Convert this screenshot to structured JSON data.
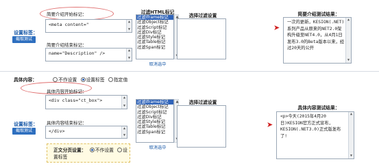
{
  "section1": {
    "settings_label": "设置标签：",
    "capture_button": "截取测试",
    "start_tag_label": "简要介绍开始标记：",
    "start_tag_value": "<meta content=\"",
    "end_tag_label": "简要介绍结束标记：",
    "end_tag_value": "name=\"Description\" />",
    "filter_title": "过滤HTML标记",
    "filter_items": [
      "过滤Iframe标记",
      "过滤Object标记",
      "过滤Script标记",
      "过滤Div标记",
      "过滤Style标记",
      "过滤Table标记",
      "过滤Span标记"
    ],
    "cancel_link": "取消选中",
    "select_title": "选择过滤设置",
    "result_title": "简要介绍测试结果：",
    "result_text": "一次的更新，KESION(.NET)系列产品从原来的NET2.0架构升级至NET4.0，从4月1日发布3.0的Beta版本以来，经过20天的公开"
  },
  "content_row": {
    "label": "具体内容：",
    "options": [
      "不作设置",
      "设置标签",
      "指定值"
    ],
    "selected": 1
  },
  "section2": {
    "settings_label": "设置标签：",
    "capture_button": "截取测试",
    "start_tag_label": "具体内容开始标记：",
    "start_tag_value": "<div class=\"ct_box\">",
    "end_tag_label": "具体内容结束标记：",
    "end_tag_value": "</div>",
    "filter_items": [
      "过滤Iframe标记",
      "过滤Object标记",
      "过滤Script标记",
      "过滤Div标记",
      "过滤Style标记",
      "过滤Table标记",
      "过滤Span标记"
    ],
    "cancel_link": "取消选中",
    "select_title": "选择过滤设置",
    "result_title": "具体内容测试结果：",
    "result_text": "<p>今天(2015年4月20日)KESION官方正式宣布，KESION(.NET3.0)正式版发布了!",
    "pagination_label": "正文分页设置：",
    "pagination_options": [
      "不作设置",
      "设置标签"
    ]
  }
}
